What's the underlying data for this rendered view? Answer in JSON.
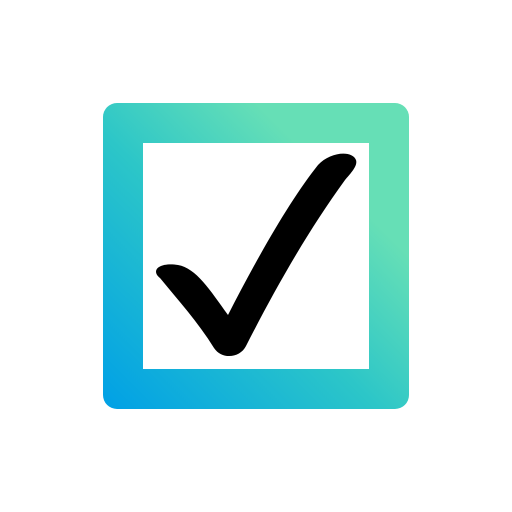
{
  "icon": {
    "name": "checkbox-checked-icon",
    "colors": {
      "background": "#ffffff",
      "frame_gradient": [
        "#00a0e6",
        "#2cc6c8",
        "#66dfb6"
      ],
      "inner_fill": "#ffffff",
      "checkmark": "#000000"
    }
  }
}
